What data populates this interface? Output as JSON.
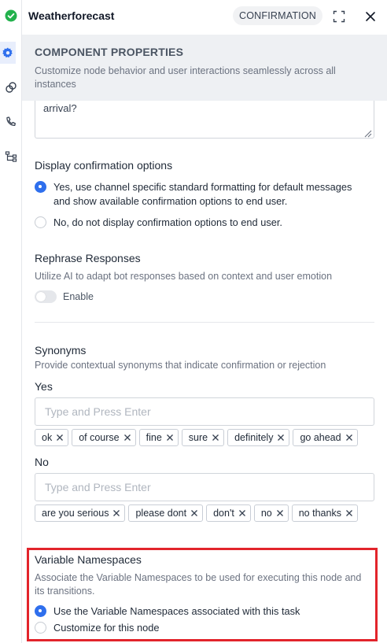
{
  "header": {
    "title": "Weatherforecast",
    "badge": "CONFIRMATION"
  },
  "properties": {
    "heading": "COMPONENT PROPERTIES",
    "subtitle": "Customize node behavior and user interactions seamlessly across all instances"
  },
  "prompt_fragment": "arrival?",
  "display_confirmation": {
    "label": "Display confirmation options",
    "options": [
      {
        "text": "Yes, use channel specific standard formatting for default messages and show available confirmation options to end user.",
        "selected": true
      },
      {
        "text": "No, do not display confirmation options to end user.",
        "selected": false
      }
    ]
  },
  "rephrase": {
    "label": "Rephrase Responses",
    "description": "Utilize AI to adapt bot responses based on context and user emotion",
    "toggle_label": "Enable",
    "enabled": false
  },
  "synonyms": {
    "label": "Synonyms",
    "description": "Provide contextual synonyms that indicate confirmation or rejection",
    "yes": {
      "label": "Yes",
      "placeholder": "Type and Press Enter",
      "chips": [
        "ok",
        "of course",
        "fine",
        "sure",
        "definitely",
        "go ahead"
      ]
    },
    "no": {
      "label": "No",
      "placeholder": "Type and Press Enter",
      "chips": [
        "are you serious",
        "please dont",
        "don't",
        "no",
        "no thanks"
      ]
    }
  },
  "variable_namespaces": {
    "label": "Variable Namespaces",
    "description": "Associate the Variable Namespaces to be used for executing this node and its transitions.",
    "options": [
      {
        "text": "Use the Variable Namespaces associated with this task",
        "selected": true
      },
      {
        "text": "Customize for this node",
        "selected": false
      }
    ]
  },
  "colors": {
    "accent": "#2f6fed",
    "highlight_border": "#e2242b",
    "success": "#22b14c"
  },
  "icons": {
    "rail": [
      "gear-icon",
      "link-icon",
      "phone-icon",
      "flow-icon"
    ],
    "header": [
      "check-circle-icon",
      "expand-icon",
      "close-icon"
    ]
  }
}
